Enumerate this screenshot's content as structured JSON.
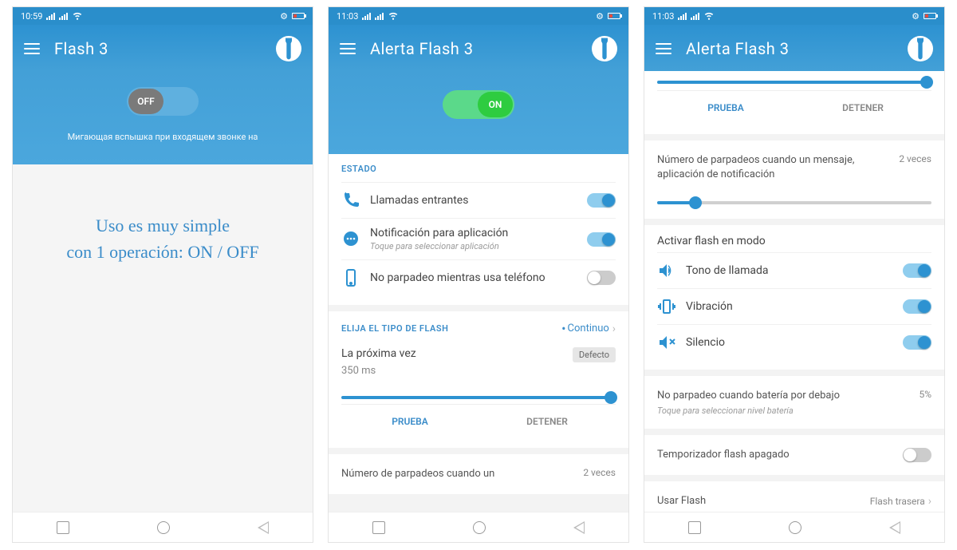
{
  "screens": [
    {
      "status_time": "10:59",
      "title": "Flash 3",
      "toggle_state": "OFF",
      "hero_sub": "Мигающая вспышка при входящем звонке на",
      "promo_line1": "Uso es muy simple",
      "promo_line2": "con 1 operación: ON / OFF"
    },
    {
      "status_time": "11:03",
      "title": "Alerta Flash 3",
      "toggle_state": "ON",
      "section_estado": "ESTADO",
      "row_calls": "Llamadas entrantes",
      "row_notif_label": "Notificación para aplicación",
      "row_notif_sub": "Toque para seleccionar aplicación",
      "row_nophone": "No parpadeo mientras usa teléfono",
      "section_flash_type": "ELIJA EL TIPO DE FLASH",
      "flash_type_value": "Continuo",
      "timing_label": "La próxima vez",
      "timing_value": "350 ms",
      "timing_badge": "Defecto",
      "tab_test": "PRUEBA",
      "tab_stop": "DETENER",
      "blink_msg_label": "Número de parpadeos cuando un",
      "blink_msg_val": "2 veces"
    },
    {
      "status_time": "11:03",
      "title": "Alerta Flash 3",
      "tab_test": "PRUEBA",
      "tab_stop": "DETENER",
      "blink_msg_label": "Número de parpadeos cuando un mensaje, aplicación de notificación",
      "blink_msg_val": "2 veces",
      "section_mode": "Activar flash en modo",
      "mode_ring": "Tono de llamada",
      "mode_vibrate": "Vibración",
      "mode_silent": "Silencio",
      "batt_label": "No parpadeo cuando batería por debajo",
      "batt_sub": "Toque para seleccionar nivel batería",
      "batt_val": "5%",
      "timer_label": "Temporizador flash apagado",
      "use_flash_label": "Usar Flash",
      "use_flash_val": "Flash trasera"
    }
  ]
}
